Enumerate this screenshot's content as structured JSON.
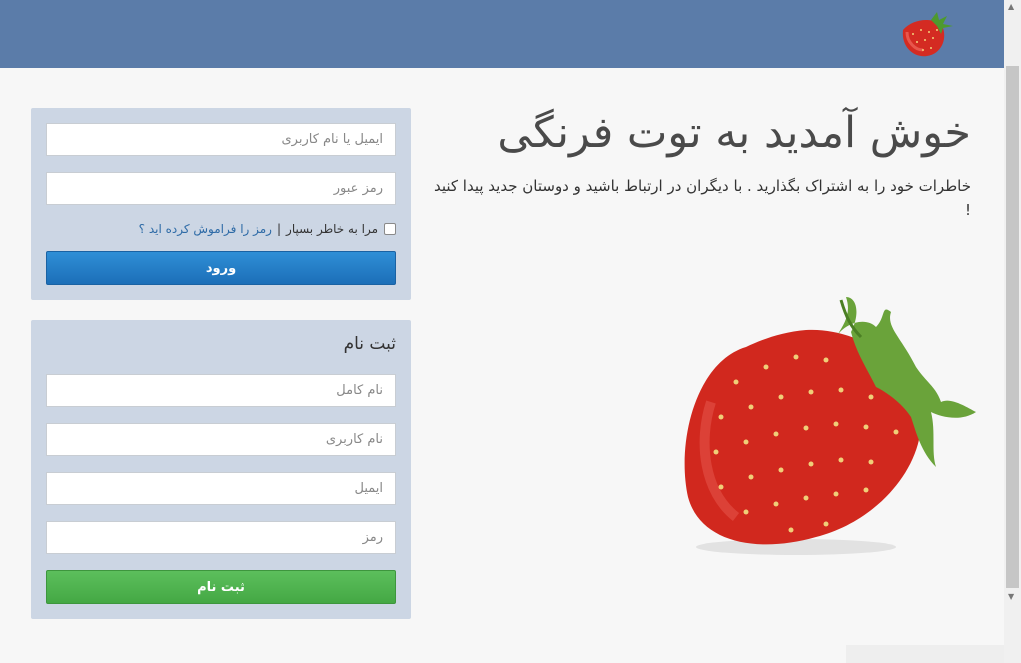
{
  "header": {
    "logo_icon": "strawberry-logo-icon",
    "background_color": "#5b7ca9"
  },
  "welcome": {
    "title": "خوش آمدید به توت فرنگی",
    "subtitle": "خاطرات خود را به اشتراک بگذارید . با دیگران در ارتباط باشید و دوستان جدید پیدا کنید !"
  },
  "login": {
    "username_placeholder": "ایمیل یا نام کاربری",
    "password_placeholder": "رمز عبور",
    "remember_label": "مرا به خاطر بسپار",
    "separator": "|",
    "forgot_link": "رمز را فراموش کرده اید ؟",
    "submit_label": "ورود"
  },
  "signup": {
    "title": "ثبت نام",
    "fullname_placeholder": "نام کامل",
    "username_placeholder": "نام کاربری",
    "email_placeholder": "ایمیل",
    "password_placeholder": "رمز",
    "submit_label": "ثبت نام"
  },
  "colors": {
    "login_button": "#2581c9",
    "signup_button": "#4cb14c",
    "panel": "#ccd6e4",
    "link": "#2d6aa6"
  },
  "illustration_icon": "strawberry-illustration"
}
